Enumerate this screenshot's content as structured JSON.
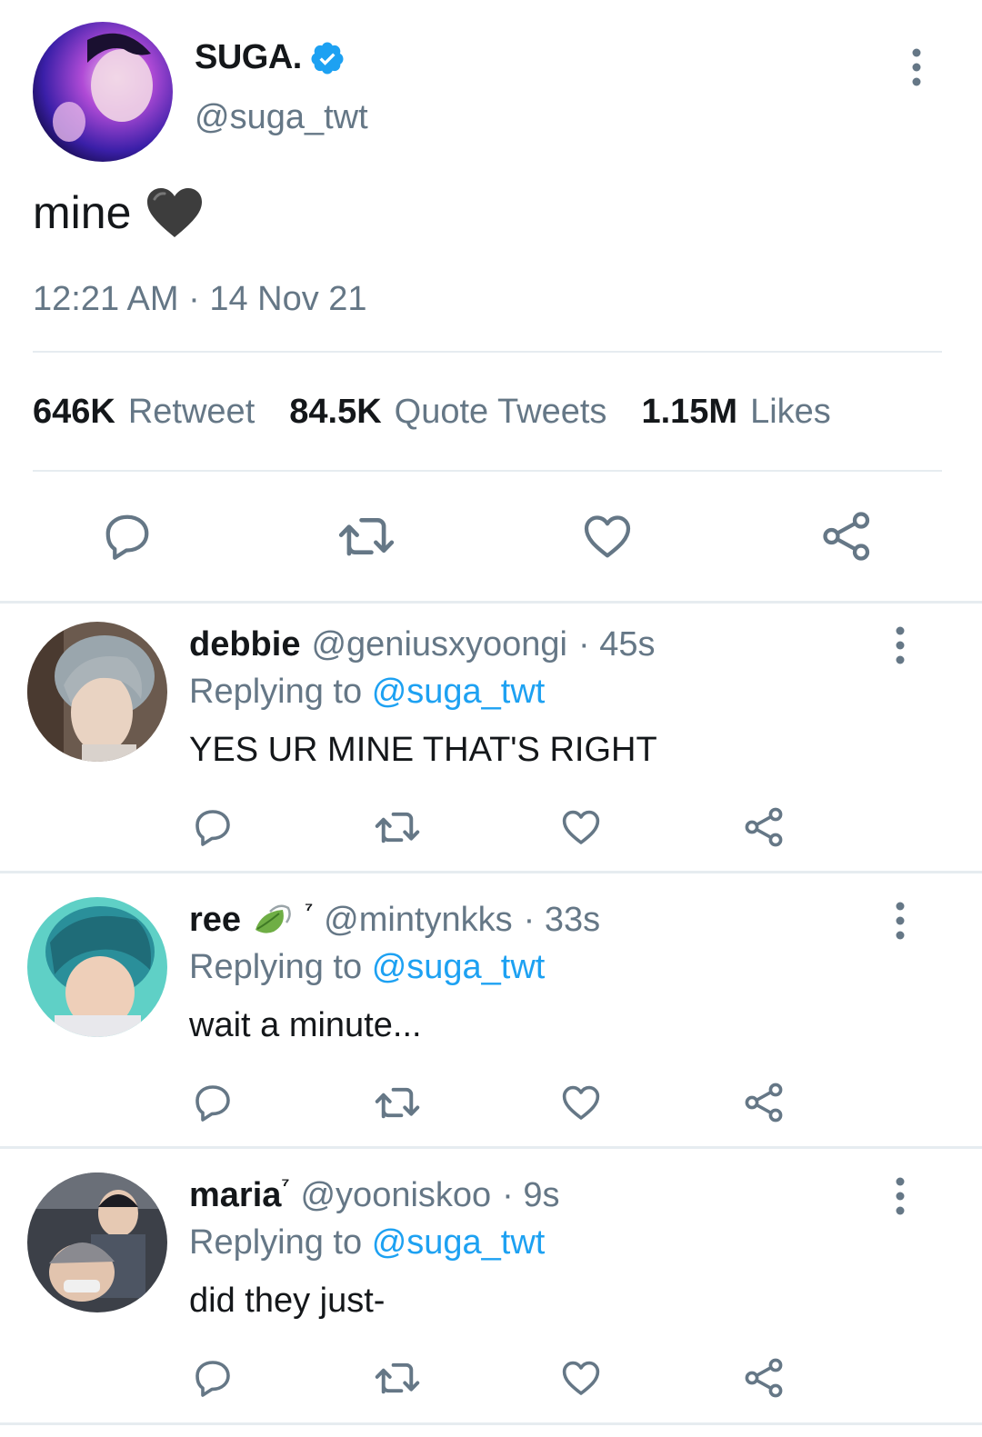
{
  "main": {
    "author_name": "SUGA.",
    "author_handle": "@suga_twt",
    "text": "mine",
    "emoji": "black-heart",
    "timestamp": "12:21 AM · 14 Nov 21",
    "stats": [
      {
        "num": "646K",
        "label": "Retweet"
      },
      {
        "num": "84.5K",
        "label": "Quote Tweets"
      },
      {
        "num": "1.15M",
        "label": "Likes"
      }
    ]
  },
  "replies": [
    {
      "name": "debbie",
      "handle": "@geniusxyoongi",
      "time": "· 45s",
      "replying_prefix": "Replying to",
      "replying_to": "@suga_twt",
      "text": "YES UR MINE THAT'S RIGHT"
    },
    {
      "name": "ree",
      "name_suffix": "⁷",
      "handle": "@mintynkks",
      "time": "· 33s",
      "replying_prefix": "Replying to",
      "replying_to": "@suga_twt",
      "text": "wait a minute..."
    },
    {
      "name": "maria",
      "name_suffix": "⁷",
      "handle": "@yooniskoo",
      "time": "· 9s",
      "replying_prefix": "Replying to",
      "replying_to": "@suga_twt",
      "text": "did they just-"
    }
  ],
  "icons": {
    "reply": "reply-icon",
    "retweet": "retweet-icon",
    "like": "like-icon",
    "share": "share-icon",
    "more": "more-vertical-icon",
    "verified": "verified-badge-icon"
  },
  "colors": {
    "text": "#14171a",
    "muted": "#657786",
    "link": "#1da1f2",
    "divider": "#e6ecf0"
  }
}
